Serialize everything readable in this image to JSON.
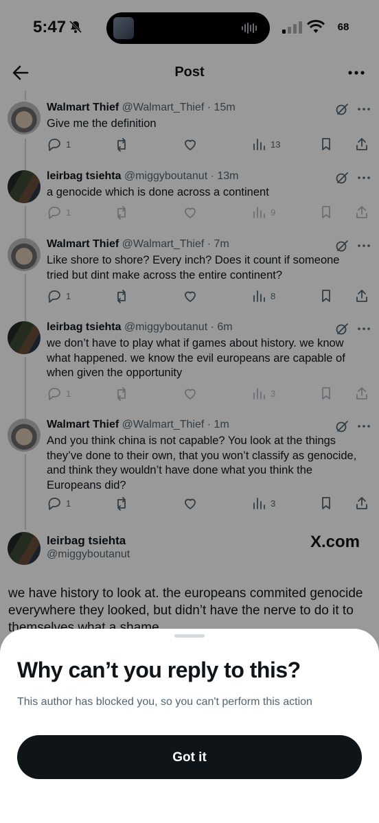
{
  "status_bar": {
    "time": "5:47",
    "battery": "68"
  },
  "header": {
    "title": "Post"
  },
  "thread": [
    {
      "name": "Walmart Thief",
      "handle": "@Walmart_Thief · 15m",
      "text": "Give me the definition",
      "replies": "1",
      "views": "13"
    },
    {
      "name": "leirbag tsiehta",
      "handle": "@miggyboutanut · 13m",
      "text": "a genocide which is done across a continent",
      "replies": "1",
      "views": "9"
    },
    {
      "name": "Walmart Thief",
      "handle": "@Walmart_Thief · 7m",
      "text": "Like shore to shore? Every inch?  Does it count if someone tried but dint make across the entire continent?",
      "replies": "1",
      "views": "8"
    },
    {
      "name": "leirbag tsiehta",
      "handle": "@miggyboutanut · 6m",
      "text": "we don’t have to play what if games about history. we know what happened. we know the evil europeans are capable of when given the opportunity",
      "replies": "1",
      "views": "3"
    },
    {
      "name": "Walmart Thief",
      "handle": "@Walmart_Thief · 1m",
      "text": "And you think china is not capable? You look at the things they’ve done to their own, that you won’t classify as genocide, and think they wouldn’t have done what you think the Europeans did?",
      "replies": "1",
      "views": "3"
    }
  ],
  "main_post": {
    "name": "leirbag tsiehta",
    "handle": "@miggyboutanut",
    "source": "X.com",
    "text": "we have history to look at. the europeans commited genocide everywhere they looked, but didn’t have the nerve to do it to themselves what a shame"
  },
  "sheet": {
    "title": "Why can’t you reply to this?",
    "subtitle": "This author has blocked you, so you can't perform this action",
    "button": "Got it"
  }
}
